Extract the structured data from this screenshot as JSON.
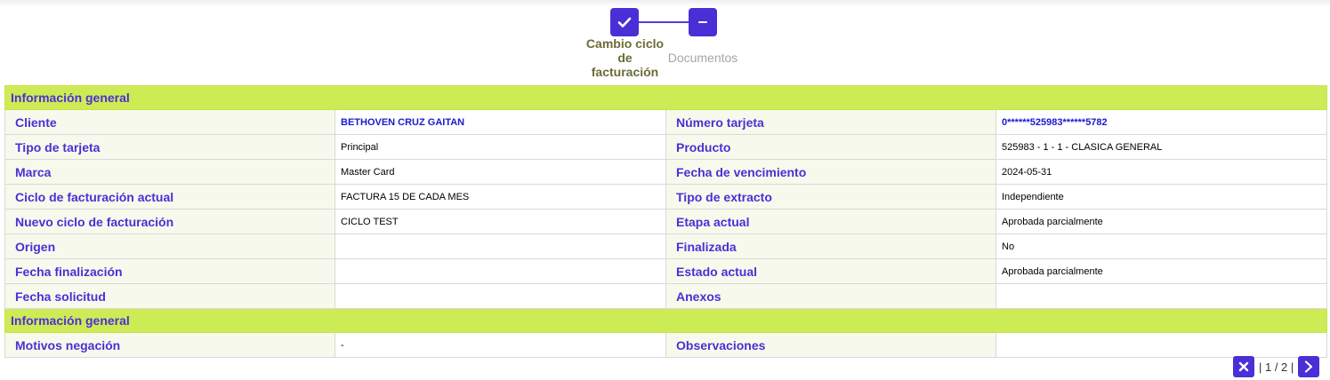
{
  "stepper": {
    "steps": [
      {
        "label": "Cambio ciclo de facturación",
        "status": "completed",
        "icon": "check-icon"
      },
      {
        "label": "Documentos",
        "status": "pending",
        "icon": "minus-icon"
      }
    ],
    "accent_color": "#4b2fd6"
  },
  "sections": [
    {
      "title": "Información general",
      "rows": [
        {
          "l1": "Cliente",
          "v1": "BETHOVEN CRUZ GAITAN",
          "l2": "Número tarjeta",
          "v2": "0******525983******5782"
        },
        {
          "l1": "Tipo de tarjeta",
          "v1": "Principal",
          "l2": "Producto",
          "v2": "525983 - 1 - 1 - CLASICA GENERAL"
        },
        {
          "l1": "Marca",
          "v1": "Master Card",
          "l2": "Fecha de vencimiento",
          "v2": "2024-05-31"
        },
        {
          "l1": "Ciclo de facturación actual",
          "v1": "FACTURA 15 DE CADA MES",
          "l2": "Tipo de extracto",
          "v2": "Independiente"
        },
        {
          "l1": "Nuevo ciclo de facturación",
          "v1": "CICLO TEST",
          "l2": "Etapa actual",
          "v2": "Aprobada parcialmente"
        },
        {
          "l1": "Origen",
          "v1": "",
          "l2": "Finalizada",
          "v2": "No"
        },
        {
          "l1": "Fecha finalización",
          "v1": "",
          "l2": "Estado actual",
          "v2": "Aprobada parcialmente"
        },
        {
          "l1": "Fecha solicitud",
          "v1": "",
          "l2": "Anexos",
          "v2": ""
        }
      ]
    },
    {
      "title": "Información general",
      "rows": [
        {
          "l1": "Motivos negación",
          "v1": "-",
          "l2": "Observaciones",
          "v2": ""
        }
      ]
    }
  ],
  "pager": {
    "text": "| 1 / 2 |",
    "close_icon": "close-icon",
    "next_icon": "chevron-right-icon"
  },
  "colors": {
    "section_header": "#cdeb55",
    "label_bg": "#f7f9ec",
    "link_value": "#1a1acc"
  }
}
